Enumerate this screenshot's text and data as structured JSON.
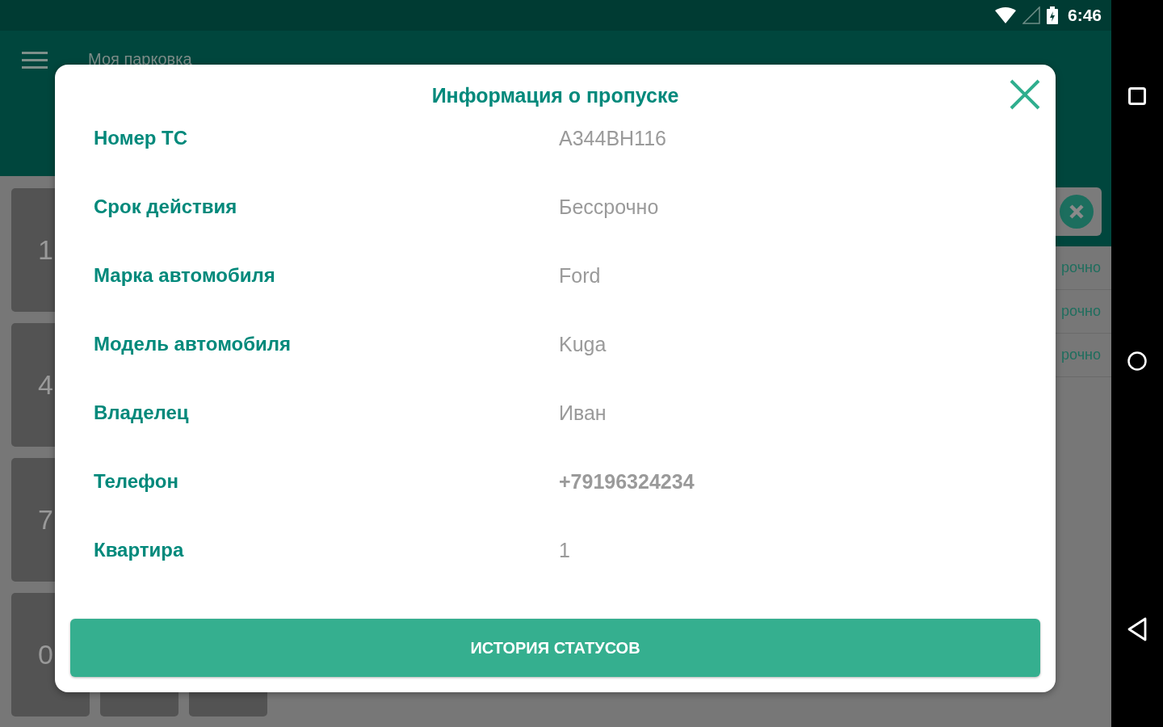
{
  "status_bar": {
    "time": "6:46"
  },
  "app_bar": {
    "title": "Моя парковка"
  },
  "keypad": {
    "keys": [
      {
        "label": "1"
      },
      {
        "label": "4"
      },
      {
        "label": "7"
      },
      {
        "label": "0"
      }
    ]
  },
  "list": {
    "rows": [
      {
        "text": "рочно"
      },
      {
        "text": "рочно"
      },
      {
        "text": "рочно"
      }
    ]
  },
  "dialog": {
    "title": "Информация о пропуске",
    "fields": [
      {
        "label": "Номер ТС",
        "value": "А344ВН116",
        "emphasized": false
      },
      {
        "label": "Срок действия",
        "value": "Бессрочно",
        "emphasized": false
      },
      {
        "label": "Марка автомобиля",
        "value": "Ford",
        "emphasized": false
      },
      {
        "label": "Модель автомобиля",
        "value": "Kuga",
        "emphasized": false
      },
      {
        "label": "Владелец",
        "value": "Иван",
        "emphasized": false
      },
      {
        "label": "Телефон",
        "value": "+79196324234",
        "emphasized": true
      },
      {
        "label": "Квартира",
        "value": "1",
        "emphasized": false
      }
    ],
    "button": "ИСТОРИЯ СТАТУСОВ"
  }
}
